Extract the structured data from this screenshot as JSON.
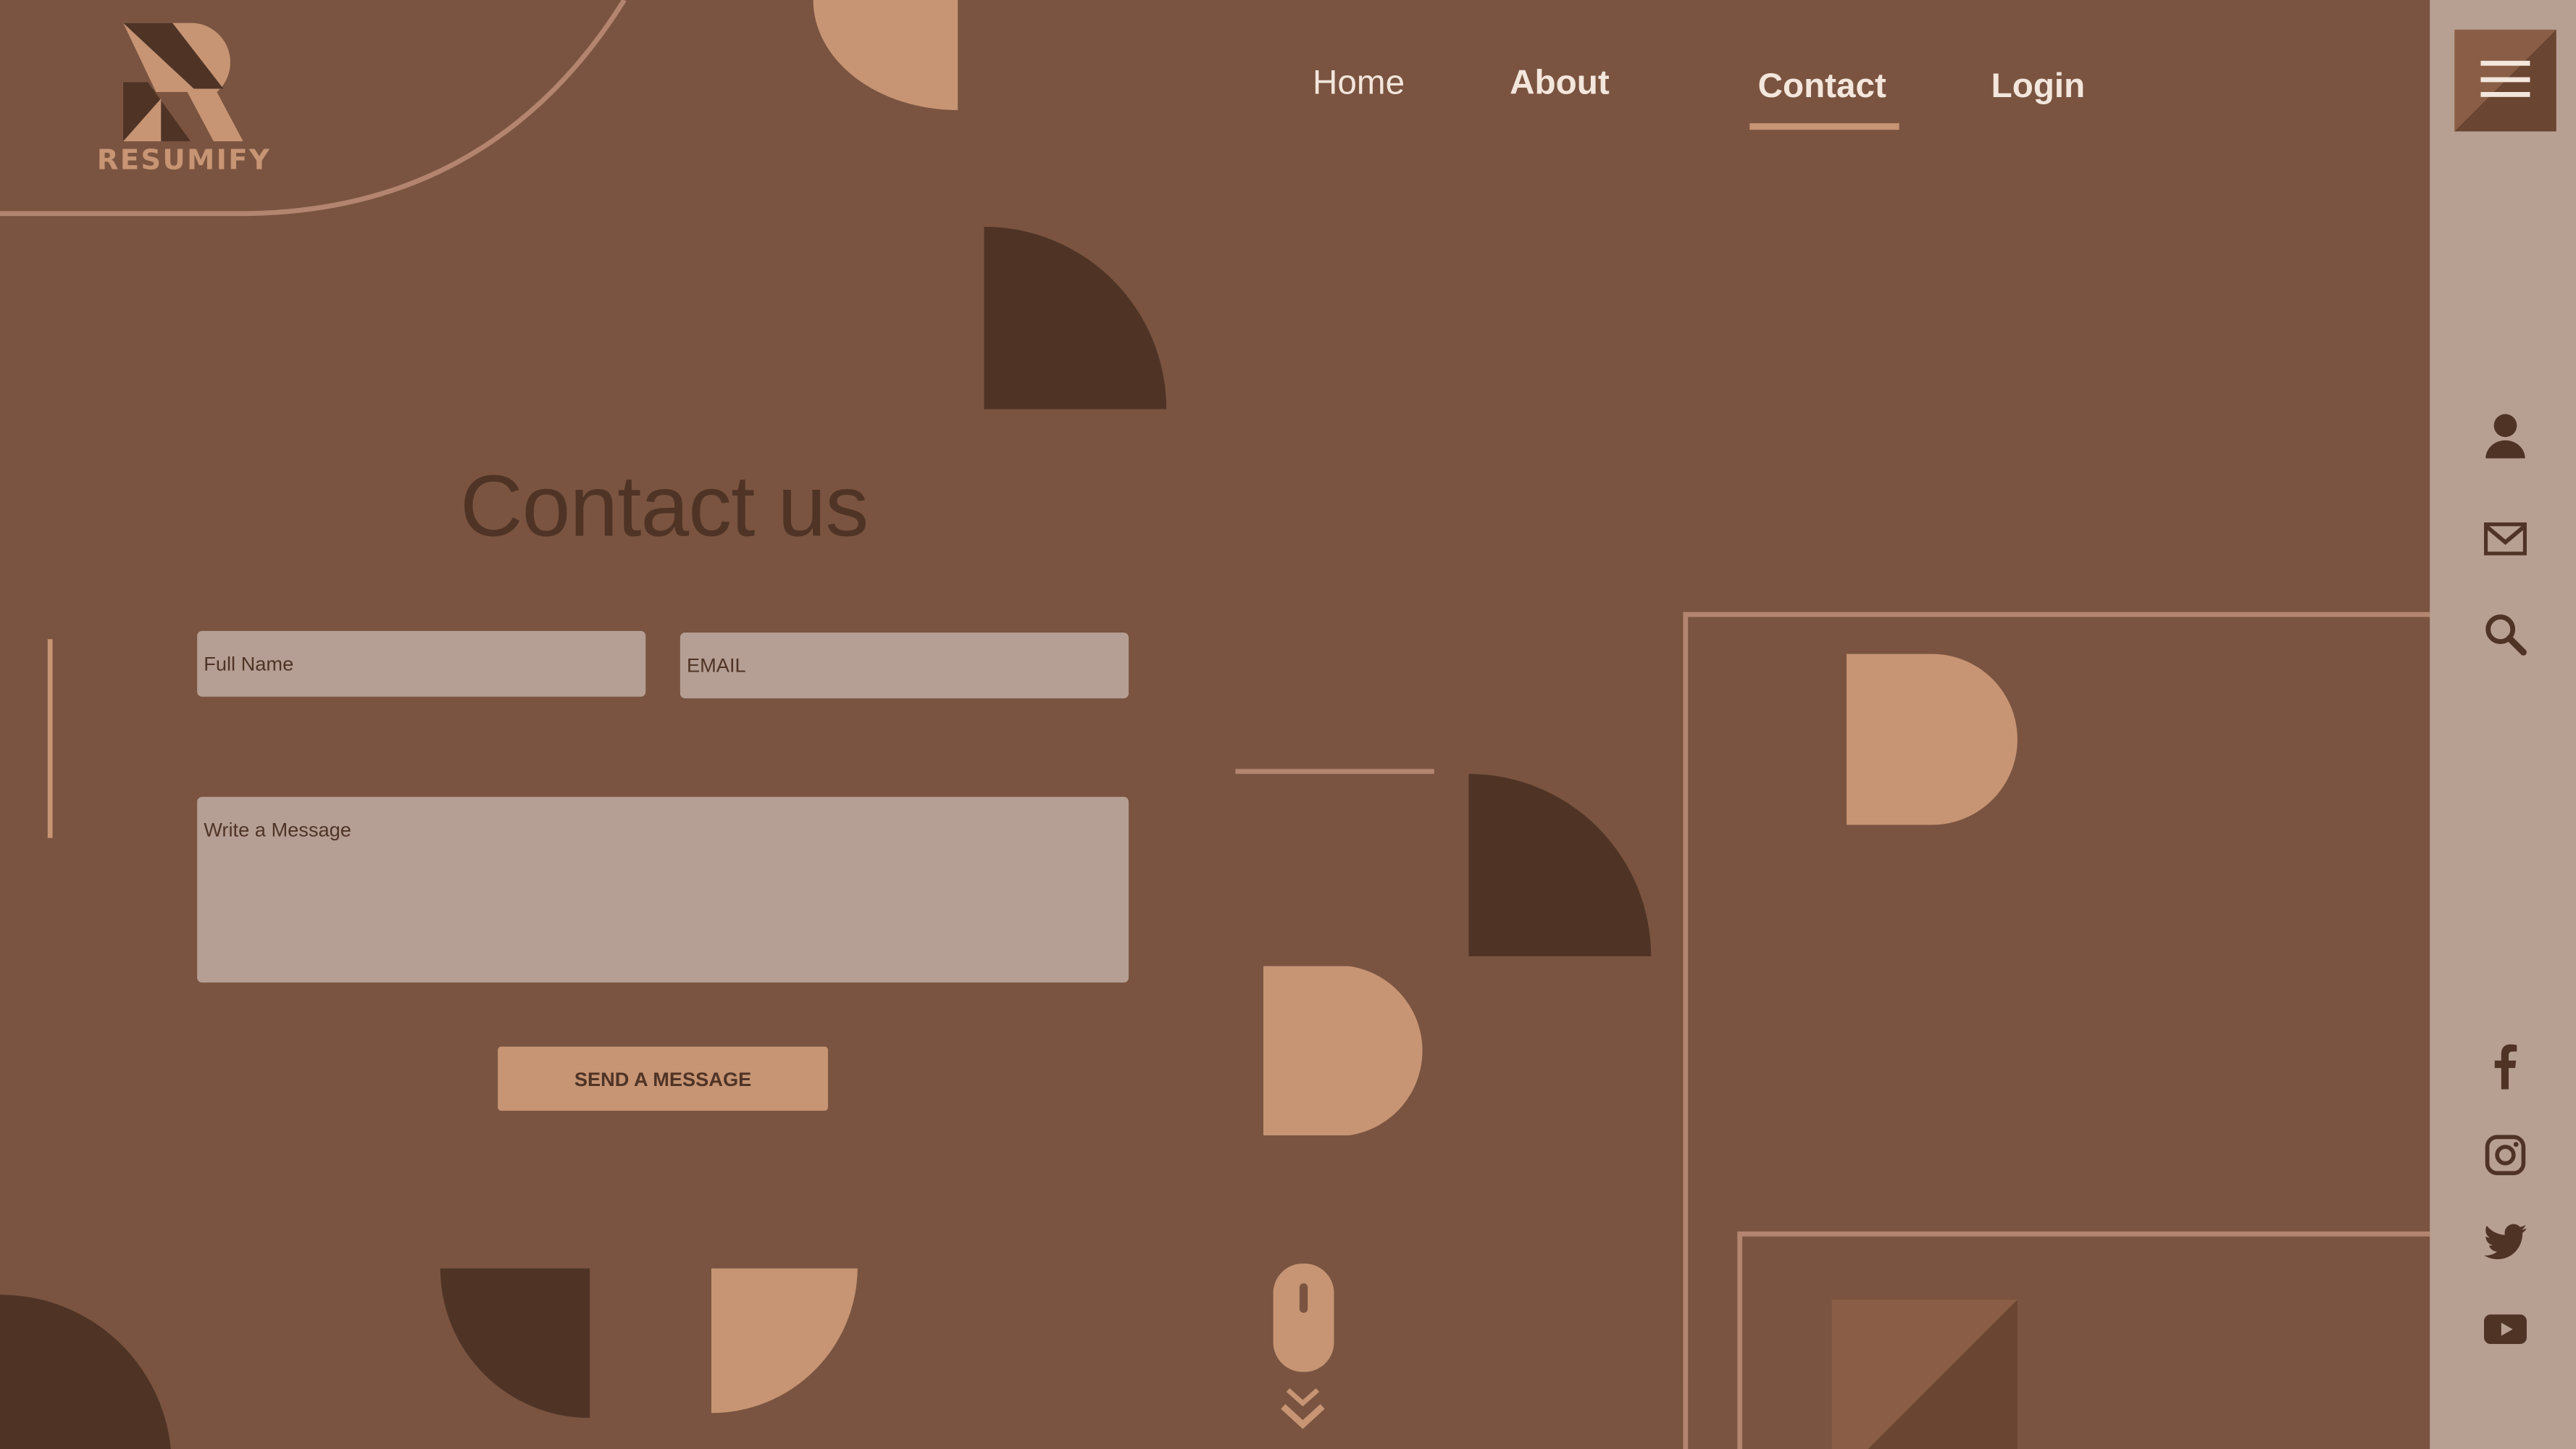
{
  "brand": {
    "name": "RESUMIFY"
  },
  "nav": {
    "items": [
      {
        "label": "Home"
      },
      {
        "label": "About"
      },
      {
        "label": "Contact"
      },
      {
        "label": "Login"
      }
    ],
    "active": "Contact"
  },
  "form": {
    "title": "Contact us",
    "name_placeholder": "Full Name",
    "email_placeholder": "EMAIL",
    "message_placeholder": "Write a Message",
    "send_label": "SEND A MESSAGE"
  },
  "sidebar": {
    "top_icons": [
      "user-icon",
      "mail-icon",
      "search-icon"
    ],
    "social_icons": [
      "facebook-icon",
      "instagram-icon",
      "twitter-icon",
      "youtube-icon"
    ]
  },
  "colors": {
    "background": "#7a5440",
    "dark": "#4f3426",
    "accent": "#c79574",
    "panel": "#b79f92",
    "text_light": "#f3e6dc"
  }
}
